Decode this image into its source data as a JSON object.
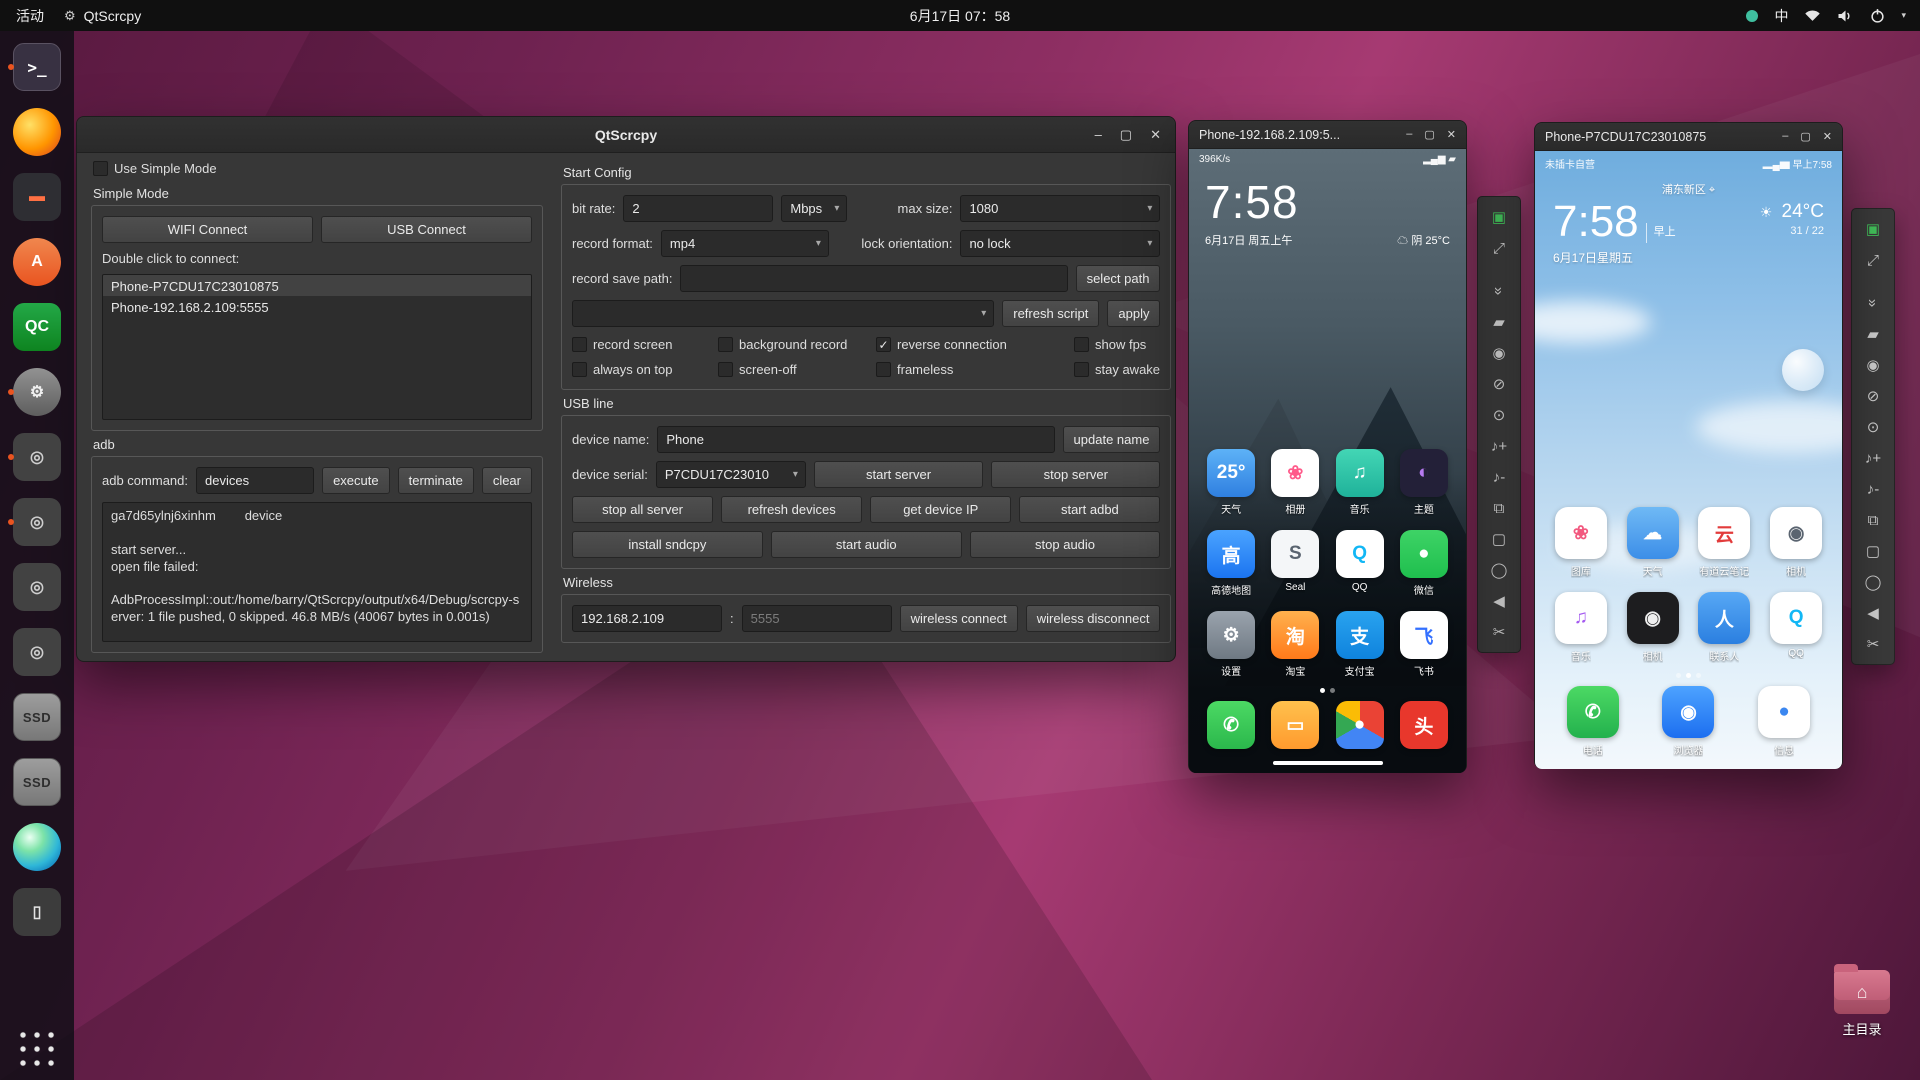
{
  "glyphs": {
    "chevron": "▾",
    "min": "–",
    "max": "▢",
    "close": "✕",
    "home": "⌂",
    "pin": "⌖"
  },
  "topbar": {
    "activities": "活动",
    "app_name": "QtScrcpy",
    "clock": "6月17日 07：58",
    "ime": "中"
  },
  "dock": {
    "items": [
      {
        "name": "terminal-icon",
        "kind": "terminal",
        "label": ">_",
        "bg": "#383142",
        "fg": "#ffffff",
        "run": "running"
      },
      {
        "name": "firefox-icon",
        "kind": "circle",
        "label": "",
        "bg": "radial-gradient(circle at 35% 35%, #ffe066, #ff9500 55%, #e2541b 88%)",
        "fg": "#ffffff",
        "run": ""
      },
      {
        "name": "text-editor-icon",
        "kind": "square",
        "label": "▬",
        "bg": "#2e2e33",
        "fg": "#ff7043",
        "run": ""
      },
      {
        "name": "ubuntu-software-icon",
        "kind": "circle",
        "label": "A",
        "bg": "linear-gradient(180deg,#f0874e,#e95420)",
        "fg": "#ffffff",
        "run": ""
      },
      {
        "name": "qc-app-icon",
        "kind": "square",
        "label": "QC",
        "bg": "linear-gradient(180deg,#23a847,#0e8420)",
        "fg": "#ffffff",
        "run": ""
      },
      {
        "name": "settings-icon",
        "kind": "circle",
        "label": "⚙",
        "bg": "linear-gradient(180deg,#929292,#5e5e5e)",
        "fg": "#f0f0f0",
        "run": "running",
        "focus": "active"
      },
      {
        "name": "device-app-icon",
        "kind": "square",
        "label": "◎",
        "bg": "#424242",
        "fg": "#cfcfcf",
        "run": "running"
      },
      {
        "name": "device-app-icon",
        "kind": "square",
        "label": "◎",
        "bg": "#424242",
        "fg": "#cfcfcf",
        "run": "running"
      },
      {
        "name": "device-app-icon",
        "kind": "square",
        "label": "◎",
        "bg": "#424242",
        "fg": "#cfcfcf",
        "run": ""
      },
      {
        "name": "device-app-icon",
        "kind": "square",
        "label": "◎",
        "bg": "#424242",
        "fg": "#cfcfcf",
        "run": ""
      },
      {
        "name": "ssd-drive-icon",
        "kind": "ssd",
        "label": "SSD",
        "bg": "linear-gradient(180deg,#9d9d9d,#787878)",
        "fg": "#2e2e2e",
        "run": ""
      },
      {
        "name": "ssd-drive-icon",
        "kind": "ssd",
        "label": "SSD",
        "bg": "linear-gradient(180deg,#9d9d9d,#787878)",
        "fg": "#2e2e2e",
        "run": ""
      },
      {
        "name": "sphere-app-icon",
        "kind": "circle",
        "label": "",
        "bg": "radial-gradient(circle at 35% 30%, #eafff2, #7de3a8 30%, #2fb7d8 62%, #0b6fb8 90%)",
        "fg": "#ffffff",
        "run": ""
      },
      {
        "name": "smartphone-icon",
        "kind": "square",
        "label": "▯",
        "bg": "#3c3c3c",
        "fg": "#e3e3e3",
        "run": ""
      },
      {
        "name": "show-apps-icon",
        "kind": "apps",
        "label": "",
        "bg": "radial-gradient(circle, #e8e8e8 2.4px, rgba(0,0,0,0) 3px) 0 0 / 33.4% 33.4%",
        "fg": "#ffffff",
        "run": ""
      }
    ]
  },
  "main": {
    "title": "QtScrcpy",
    "simple": {
      "use_simple_mode": "Use Simple Mode",
      "section": "Simple Mode",
      "wifi_btn": "WIFI Connect",
      "usb_btn": "USB Connect",
      "hint": "Double click to connect:",
      "devices": [
        {
          "label": "Phone-P7CDU17C23010875",
          "state": "selected"
        },
        {
          "label": "Phone-192.168.2.109:5555",
          "state": ""
        }
      ]
    },
    "adb": {
      "section": "adb",
      "cmd_label": "adb command:",
      "cmd_value": "devices",
      "execute": "execute",
      "terminate": "terminate",
      "clear": "clear",
      "log": "ga7d65ylnj6xinhm        device\n\nstart server...\nopen file failed:\n\nAdbProcessImpl::out:/home/barry/QtScrcpy/output/x64/Debug/scrcpy-server: 1 file pushed, 0 skipped. 46.8 MB/s (40067 bytes in 0.001s)"
    },
    "config": {
      "section": "Start Config",
      "bit_rate_label": "bit rate:",
      "bit_rate": "2",
      "bit_rate_unit": "Mbps",
      "max_size_label": "max size:",
      "max_size": "1080",
      "record_format_label": "record format:",
      "record_format": "mp4",
      "lock_orientation_label": "lock orientation:",
      "lock_orientation": "no lock",
      "record_save_path_label": "record save path:",
      "record_save_path": "",
      "select_path": "select path",
      "script": "",
      "refresh_script": "refresh script",
      "apply": "apply",
      "options": [
        {
          "label": "record screen",
          "state": ""
        },
        {
          "label": "background record",
          "state": ""
        },
        {
          "label": "reverse connection",
          "state": "checked"
        },
        {
          "label": "show fps",
          "state": ""
        },
        {
          "label": "always on top",
          "state": ""
        },
        {
          "label": "screen-off",
          "state": ""
        },
        {
          "label": "frameless",
          "state": ""
        },
        {
          "label": "stay awake",
          "state": ""
        }
      ]
    },
    "usb": {
      "section": "USB line",
      "device_name_label": "device name:",
      "device_name": "Phone",
      "update_name": "update name",
      "device_serial_label": "device serial:",
      "device_serial": "P7CDU17C23010",
      "start_server": "start server",
      "stop_server": "stop server",
      "stop_all_server": "stop all server",
      "refresh_devices": "refresh devices",
      "get_device_ip": "get device IP",
      "start_adbd": "start adbd",
      "install_sndcpy": "install sndcpy",
      "start_audio": "start audio",
      "stop_audio": "stop audio"
    },
    "wireless": {
      "section": "Wireless",
      "ip": "192.168.2.109",
      "sep": ":",
      "port_placeholder": "5555",
      "connect": "wireless connect",
      "disconnect": "wireless disconnect"
    }
  },
  "phone1": {
    "title": "Phone-192.168.2.109:5...",
    "status_left": "396K/s",
    "status_right": "▂▄▆ ▰",
    "clock": "7:58",
    "date": "6月17日 周五上午",
    "weather_icon": "☁",
    "weather": "阴 25°C",
    "apps": [
      {
        "label": "天气",
        "glyph": "25°",
        "bg": "linear-gradient(180deg,#5db2f7,#2f7fe0)",
        "fg": "#ffffff"
      },
      {
        "label": "相册",
        "glyph": "❀",
        "bg": "#ffffff",
        "fg": "#ff5a8a"
      },
      {
        "label": "音乐",
        "glyph": "♫",
        "bg": "linear-gradient(180deg,#43d6b5,#1fb29a)",
        "fg": "#ffffff"
      },
      {
        "label": "主题",
        "glyph": "◐",
        "bg": "#232038",
        "fg": "#b67af0"
      },
      {
        "label": "高德地图",
        "glyph": "高",
        "bg": "linear-gradient(180deg,#4aa3ff,#1b74f0)",
        "fg": "#ffffff"
      },
      {
        "label": "Seal",
        "glyph": "S",
        "bg": "#f4f6f8",
        "fg": "#5a6470"
      },
      {
        "label": "QQ",
        "glyph": "Q",
        "bg": "#ffffff",
        "fg": "#12b7f5"
      },
      {
        "label": "微信",
        "glyph": "●",
        "bg": "linear-gradient(180deg,#3ed366,#1fbf4e)",
        "fg": "#ffffff"
      },
      {
        "label": "设置",
        "glyph": "⚙",
        "bg": "linear-gradient(180deg,#9aa3ad,#6f7983)",
        "fg": "#ffffff"
      },
      {
        "label": "淘宝",
        "glyph": "淘",
        "bg": "linear-gradient(180deg,#ffb14e,#ff7a1a)",
        "fg": "#ffffff"
      },
      {
        "label": "支付宝",
        "glyph": "支",
        "bg": "linear-gradient(180deg,#29a3ef,#0f83dd)",
        "fg": "#ffffff"
      },
      {
        "label": "飞书",
        "glyph": "飞",
        "bg": "#ffffff",
        "fg": "#3370ff"
      }
    ],
    "dock": [
      {
        "name": "phone-app-icon",
        "label": "",
        "glyph": "✆",
        "bg": "linear-gradient(180deg,#4cd964,#2bb84c)",
        "fg": "#ffffff"
      },
      {
        "name": "messages-app-icon",
        "label": "",
        "glyph": "▭",
        "bg": "linear-gradient(180deg,#ffc14d,#ff9a2e)",
        "fg": "#ffffff"
      },
      {
        "name": "chrome-icon",
        "label": "",
        "glyph": "●",
        "bg": "conic-gradient(#ea4335 0deg 120deg, #4285f4 120deg 240deg, #34a853 240deg 300deg, #fbbc05 300deg 360deg)",
        "fg": "#ffffff"
      },
      {
        "name": "toutiao-icon",
        "label": "",
        "glyph": "头",
        "bg": "#e8372c",
        "fg": "#ffffff"
      }
    ]
  },
  "phone2": {
    "title": "Phone-P7CDU17C23010875",
    "status_left": "未插卡自营",
    "status_right": "▂▄▆ 早上7:58",
    "location": "浦东新区",
    "clock": "7:58",
    "ampm": "早上",
    "date": "6月17日星期五",
    "weather_icon": "☀",
    "temp": "24°C",
    "range": "31 / 22",
    "apps": [
      {
        "label": "图库",
        "glyph": "❀",
        "bg": "#ffffff",
        "fg": "#f2597f"
      },
      {
        "label": "天气",
        "glyph": "☁",
        "bg": "linear-gradient(180deg,#6fb9f5,#3c8ee8)",
        "fg": "#ffffff"
      },
      {
        "label": "有道云笔记",
        "glyph": "云",
        "bg": "#ffffff",
        "fg": "#e23b3b"
      },
      {
        "label": "相机",
        "glyph": "◉",
        "bg": "#ffffff",
        "fg": "#5a6470"
      },
      {
        "label": "音乐",
        "glyph": "♫",
        "bg": "#ffffff",
        "fg": "#a55bf0"
      },
      {
        "label": "相机",
        "glyph": "◉",
        "bg": "#1d1d1f",
        "fg": "#f0f0f0"
      },
      {
        "label": "联系人",
        "glyph": "人",
        "bg": "linear-gradient(180deg,#57a8f5,#2b7fe0)",
        "fg": "#ffffff"
      },
      {
        "label": "QQ",
        "glyph": "Q",
        "bg": "#ffffff",
        "fg": "#12b7f5"
      }
    ],
    "dock": [
      {
        "name": "phone-app-icon",
        "label": "电话",
        "glyph": "✆",
        "bg": "linear-gradient(180deg,#4cd964,#23b14d)",
        "fg": "#ffffff"
      },
      {
        "name": "browser-app-icon",
        "label": "浏览器",
        "glyph": "◉",
        "bg": "linear-gradient(180deg,#4da3ff,#1c6ef0)",
        "fg": "#ffffff"
      },
      {
        "name": "messages-app-icon",
        "label": "信息",
        "glyph": "●",
        "bg": "#ffffff",
        "fg": "#3b87f0"
      }
    ]
  },
  "toolbar": {
    "icons": [
      {
        "name": "cast-screen-icon",
        "glyph": "▣",
        "color": "#43c25b"
      },
      {
        "name": "fullscreen-icon",
        "glyph": "⤢"
      },
      {
        "name": "collapse-icon",
        "glyph": "»"
      },
      {
        "name": "touch-icon",
        "glyph": "▰"
      },
      {
        "name": "screen-on-icon",
        "glyph": "◉"
      },
      {
        "name": "screen-off-icon",
        "glyph": "⊘"
      },
      {
        "name": "power-icon",
        "glyph": "⊙"
      },
      {
        "name": "volume-up-icon",
        "glyph": "♪+"
      },
      {
        "name": "volume-down-icon",
        "glyph": "♪-"
      },
      {
        "name": "app-switch-icon",
        "glyph": "⧉"
      },
      {
        "name": "menu-icon",
        "glyph": "▢"
      },
      {
        "name": "home-icon",
        "glyph": "◯"
      },
      {
        "name": "back-icon",
        "glyph": "◀"
      },
      {
        "name": "screenshot-icon",
        "glyph": "✂"
      }
    ]
  },
  "desktop": {
    "home_label": "主目录"
  }
}
